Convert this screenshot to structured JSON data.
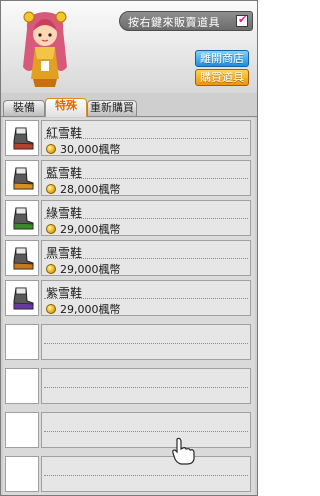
{
  "header": {
    "checkbox_label": "按右鍵來販賣道具",
    "checkbox_checked": true,
    "leave_button": "離開商店",
    "buy_button": "購買道具"
  },
  "tabs": [
    {
      "label": "裝備",
      "active": false
    },
    {
      "label": "特殊",
      "active": true
    },
    {
      "label": "重新購買",
      "active": false
    }
  ],
  "items": [
    {
      "name": "紅雪鞋",
      "price": "30,000楓幣",
      "color": "#b8402a"
    },
    {
      "name": "藍雪鞋",
      "price": "28,000楓幣",
      "color": "#d8901a"
    },
    {
      "name": "綠雪鞋",
      "price": "29,000楓幣",
      "color": "#3a8a2a"
    },
    {
      "name": "黑雪鞋",
      "price": "29,000楓幣",
      "color": "#c87818"
    },
    {
      "name": "紫雪鞋",
      "price": "29,000楓幣",
      "color": "#6a3aa0"
    }
  ],
  "empty_rows": 4,
  "colors": {
    "accent_orange": "#f09500",
    "accent_blue": "#1f8fe0"
  }
}
